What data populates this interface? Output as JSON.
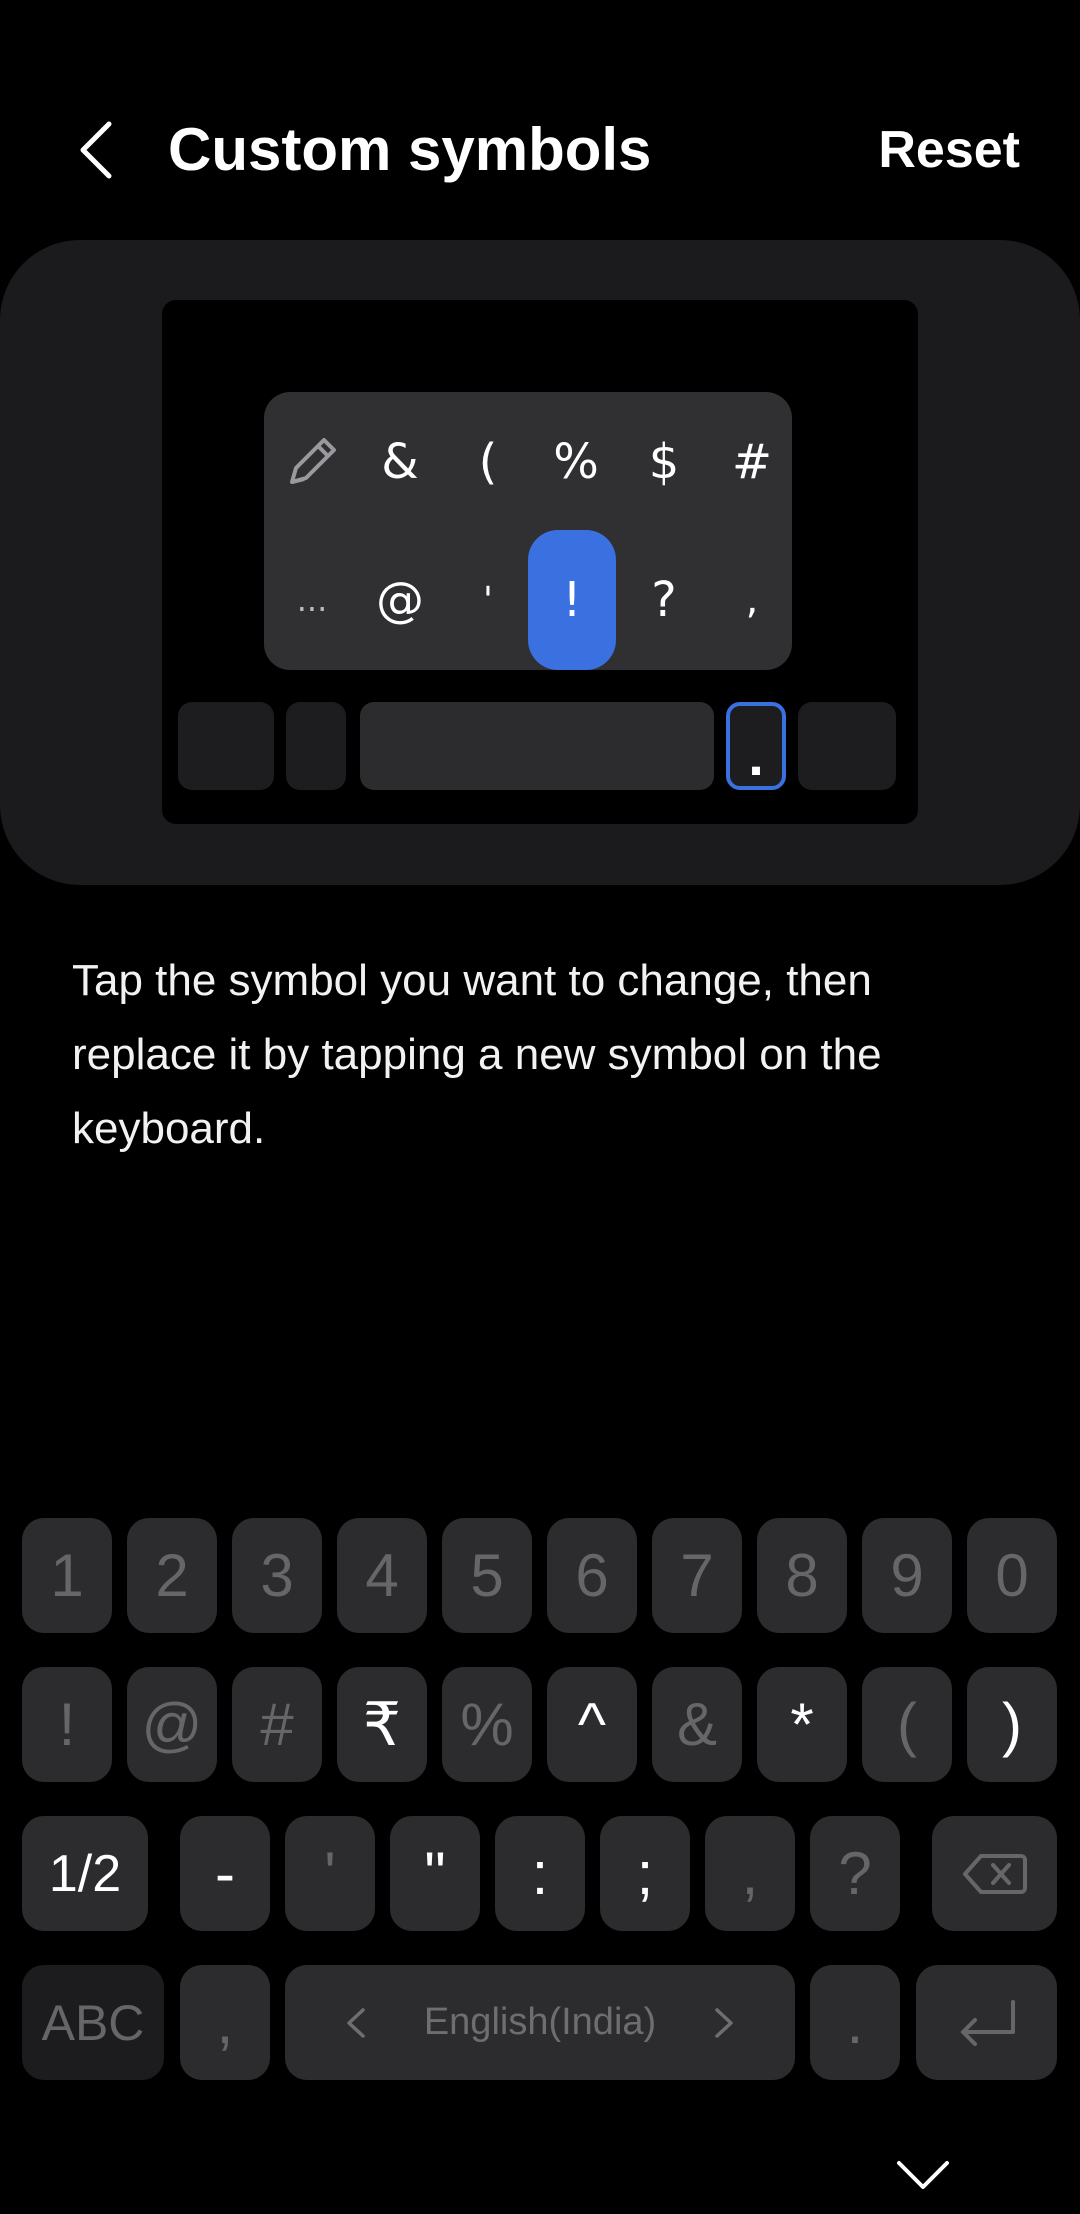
{
  "header": {
    "title": "Custom symbols",
    "reset_label": "Reset"
  },
  "preview": {
    "popup_row1": [
      "&",
      "(",
      "%",
      "$",
      "#"
    ],
    "popup_row2": [
      "...",
      "@",
      "'",
      "!",
      "?",
      ","
    ],
    "selected_symbol": "!",
    "period_key": "."
  },
  "instructions": "Tap the symbol you want to change, then replace it by tapping a new symbol on the keyboard.",
  "keyboard": {
    "row1": [
      "1",
      "2",
      "3",
      "4",
      "5",
      "6",
      "7",
      "8",
      "9",
      "0"
    ],
    "row2": [
      "!",
      "@",
      "#",
      "₹",
      "%",
      "^",
      "&",
      "*",
      "(",
      ")"
    ],
    "row3": [
      "-",
      "'",
      "\"",
      ":",
      ";",
      ",",
      "?"
    ],
    "page_label": "1/2",
    "abc_label": "ABC",
    "comma_label": ",",
    "language_label": "English(India)",
    "period_label": ".",
    "bright_row2": [
      "₹",
      "^",
      "*",
      ")"
    ],
    "bright_row3": [
      "-",
      "\"",
      ":",
      ";"
    ]
  },
  "colors": {
    "accent": "#3a70e0",
    "background": "#000000",
    "card": "#1b1b1d",
    "key": "#2c2c2e"
  }
}
